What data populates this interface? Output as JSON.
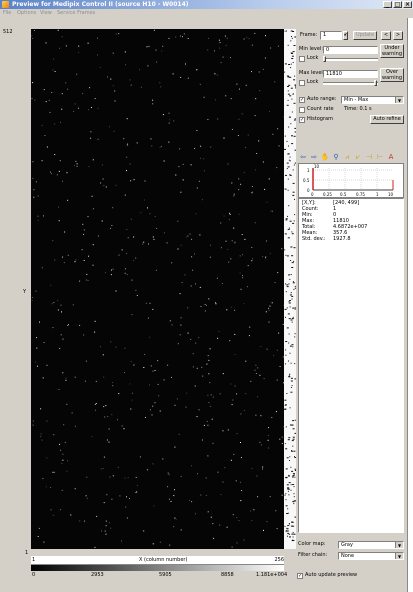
{
  "window": {
    "title": "Preview for Medipix Control II (source H10 - W0014)"
  },
  "menu": [
    "File",
    "Options",
    "View",
    "Service Frames"
  ],
  "image_panel": {
    "y_top": "512",
    "y_label": "Y",
    "y_bottom": "1",
    "x_start": "1",
    "x_label": "X (column number)",
    "x_end": "256",
    "colorbar_ticks": [
      "0",
      "2953",
      "5905",
      "8858",
      "1.181e+004"
    ]
  },
  "controls": {
    "frame_label": "Frame:",
    "frame_value": "1",
    "update_label": "Update",
    "prev": "<",
    "next": ">",
    "min_level_label": "Min level:",
    "min_level_value": "0",
    "under_warning": "Under warning",
    "lock_label": "Lock",
    "max_level_label": "Max level:",
    "max_level_value": "11810",
    "over_warning": "Over warning",
    "auto_range_label": "Auto range:",
    "auto_range_value": "Min - Max",
    "count_rate_label": "Count rate",
    "time_label": "Time: 0.1 s",
    "histogram_label": "Histogram",
    "auto_refine": "Auto refine",
    "hist_y_ticks": [
      "1",
      "0.5",
      "0"
    ],
    "hist_x_ticks": [
      "0",
      "0.25",
      "0.5",
      "0.75",
      "1"
    ],
    "hist_exp_top": "10",
    "hist_exp_right": "10"
  },
  "stats": [
    {
      "k": "[X,Y]:",
      "v": "[240, 499]"
    },
    {
      "k": "Count:",
      "v": "1"
    },
    {
      "k": "Min:",
      "v": "0"
    },
    {
      "k": "Max:",
      "v": "11810"
    },
    {
      "k": "Total:",
      "v": "4.6872e+007"
    },
    {
      "k": "Mean:",
      "v": "357.6"
    },
    {
      "k": "Std. dev.:",
      "v": "1927.8"
    }
  ],
  "bottom": {
    "color_map_label": "Color map:",
    "color_map_value": "Gray",
    "filter_chain_label": "Filter chain:",
    "filter_chain_value": "None",
    "auto_update_label": "Auto update preview"
  }
}
